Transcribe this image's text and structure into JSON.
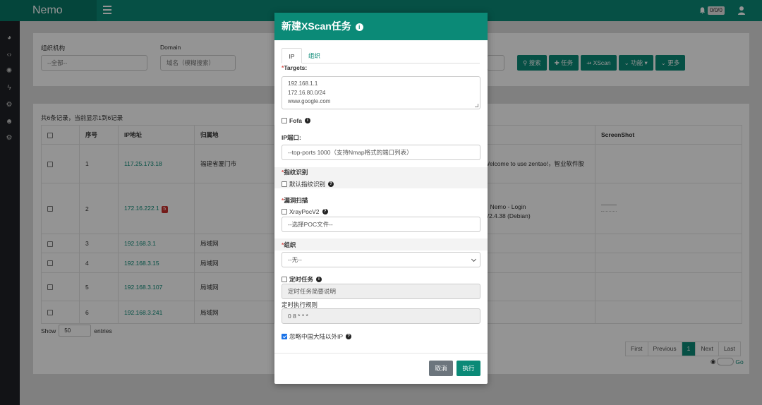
{
  "app": {
    "brand": "Nemo",
    "notification_count": "0/0/0"
  },
  "sidebar": {
    "icons": [
      "dashboard-icon",
      "code-icon",
      "bug-icon",
      "bolt-icon",
      "cogs-icon",
      "users-icon",
      "settings-icon"
    ]
  },
  "filters": {
    "org_label": "组织机构",
    "org_value": "--全部--",
    "domain_label": "Domain",
    "domain_placeholder": "域名（模糊搜索）"
  },
  "toolbar": {
    "search": "搜索",
    "task": "任务",
    "xscan": "XScan",
    "function": "功能",
    "more": "更多"
  },
  "list": {
    "summary": "共6条记录，当前显示1到6记录",
    "columns": {
      "index": "序号",
      "ip": "IP地址",
      "location": "归属地",
      "screenshot": "ScreenShot"
    },
    "rows": [
      {
        "index": "1",
        "ip": "117.25.173.18",
        "location": "福建省厦门市",
        "info": "Welcome to use zentao!，智业软件股",
        "tag": ""
      },
      {
        "index": "2",
        "ip": "172.16.222.1",
        "location": "",
        "info_line1": "，Nemo - Login",
        "info_line2": "e/2.4.38 (Debian)",
        "tag": "5"
      },
      {
        "index": "3",
        "ip": "192.168.3.1",
        "location": "局域网"
      },
      {
        "index": "4",
        "ip": "192.168.3.15",
        "location": "局域网"
      },
      {
        "index": "5",
        "ip": "192.168.3.107",
        "location": "局域网"
      },
      {
        "index": "6",
        "ip": "192.168.3.241",
        "location": "局域网"
      }
    ],
    "show_label": "Show",
    "page_size": "50",
    "entries_label": "entries"
  },
  "pagination": {
    "first": "First",
    "previous": "Previous",
    "current": "1",
    "next": "Next",
    "last": "Last",
    "go": "Go"
  },
  "modal": {
    "title": "新建XScan任务",
    "tab_ip": "IP",
    "tab_org": "组织",
    "targets_label": "Targets:",
    "targets_lines": [
      "192.168.1.1",
      "172.16.80.0/24",
      "www.google.com"
    ],
    "fofa_label": "Fofa",
    "port_label": "IP端口:",
    "port_placeholder": "--top-ports 1000（支持Nmap格式的端口列表）",
    "fingerprint_label": "指纹识别",
    "fingerprint_default": "默认指纹识别",
    "vuln_label": "漏洞扫描",
    "xraypoc_label": "XrayPocV2",
    "poc_placeholder": "--选择POC文件--",
    "org_label": "组织",
    "org_value": "--无--",
    "cron_task_label": "定时任务",
    "cron_desc_placeholder": "定时任务简要说明",
    "cron_rule_label": "定时执行规则",
    "cron_rule_value": "0 8 * * *",
    "ignore_foreign_label": "忽略中国大陆以外IP",
    "ignore_foreign_checked": true,
    "cancel": "取消",
    "execute": "执行"
  },
  "colors": {
    "primary": "#0b8a77",
    "danger": "#c9302c",
    "sidebar": "#1f2226"
  }
}
